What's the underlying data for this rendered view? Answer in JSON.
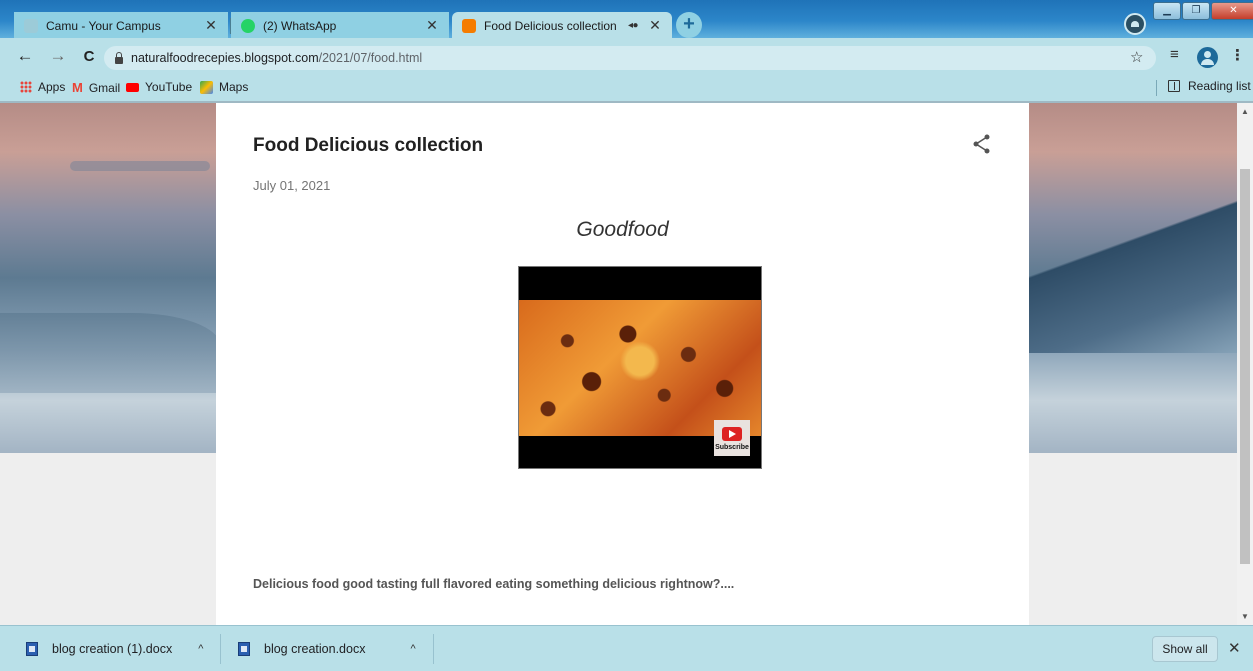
{
  "browser": {
    "tabs": [
      {
        "title": "Camu - Your Campus",
        "favicon_color": "#9ccbd8",
        "active": false
      },
      {
        "title": "(2) WhatsApp",
        "favicon_color": "#25d366",
        "active": false
      },
      {
        "title": "Food Delicious collection",
        "favicon_color": "#f57c00",
        "active": true,
        "audio_icon": "◂⦁"
      }
    ],
    "close_glyph": "✕",
    "new_tab_glyph": "+",
    "window_controls": {
      "minimize": "▁",
      "maximize": "❐",
      "close": "✕"
    }
  },
  "toolbar": {
    "back": "←",
    "forward": "→",
    "reload": "C",
    "url_host": "naturalfoodrecepies.blogspot.com",
    "url_path": "/2021/07/food.html",
    "star": "☆",
    "media": "≡",
    "menu": "⋮"
  },
  "bookmarks": [
    {
      "label": "Apps",
      "icon": "apps-grid-icon"
    },
    {
      "label": "Gmail",
      "icon": "gmail-icon",
      "glyph": "M",
      "color": "#ea4335"
    },
    {
      "label": "YouTube",
      "icon": "youtube-icon",
      "color": "#ff0000"
    },
    {
      "label": "Maps",
      "icon": "maps-icon",
      "color": "#34a853"
    }
  ],
  "reading_list": "Reading list",
  "post": {
    "title": "Food Delicious collection",
    "date": "July 01, 2021",
    "subtitle": "Goodfood",
    "video_badge": "Subscribe",
    "body": "Delicious food good tasting full flavored eating something delicious rightnow?...."
  },
  "downloads": {
    "items": [
      {
        "name": "blog creation (1).docx",
        "caret": "^"
      },
      {
        "name": "blog creation.docx",
        "caret": "^"
      }
    ],
    "show_all": "Show all",
    "close": "✕"
  },
  "scrollbar": {
    "up": "▲",
    "down": "▼"
  }
}
